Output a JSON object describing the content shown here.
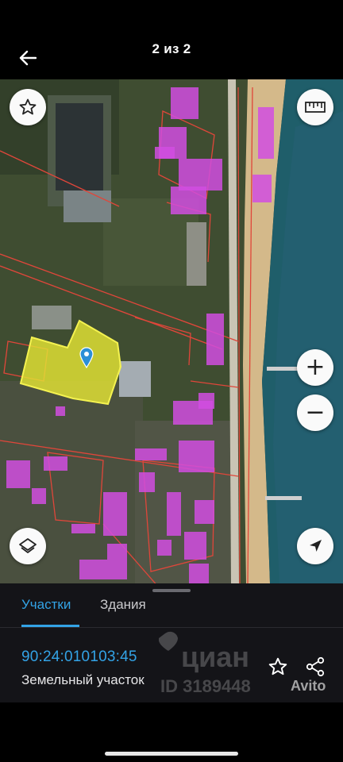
{
  "header": {
    "title": "2 из 2"
  },
  "map": {
    "zoom_in_symbol": "+",
    "zoom_out_symbol": "−",
    "icons": [
      "star-icon",
      "ruler-icon",
      "layers-icon",
      "location-arrow-icon",
      "map-pin-icon"
    ],
    "colors": {
      "selected_parcel": "#e4e434",
      "building": "#d14de0",
      "boundary": "#e0463a",
      "sea": "#1f5e6a",
      "beach": "#d4b98a"
    }
  },
  "tabs": {
    "items": [
      {
        "label": "Участки",
        "active": true
      },
      {
        "label": "Здания",
        "active": false
      }
    ],
    "accent": "#33a3e6"
  },
  "parcel": {
    "cadastral_number": "90:24:010103:45",
    "type": "Земельный участок"
  },
  "watermark": {
    "cian": "циан",
    "id": "ID 3189448",
    "avito": "Avito"
  }
}
